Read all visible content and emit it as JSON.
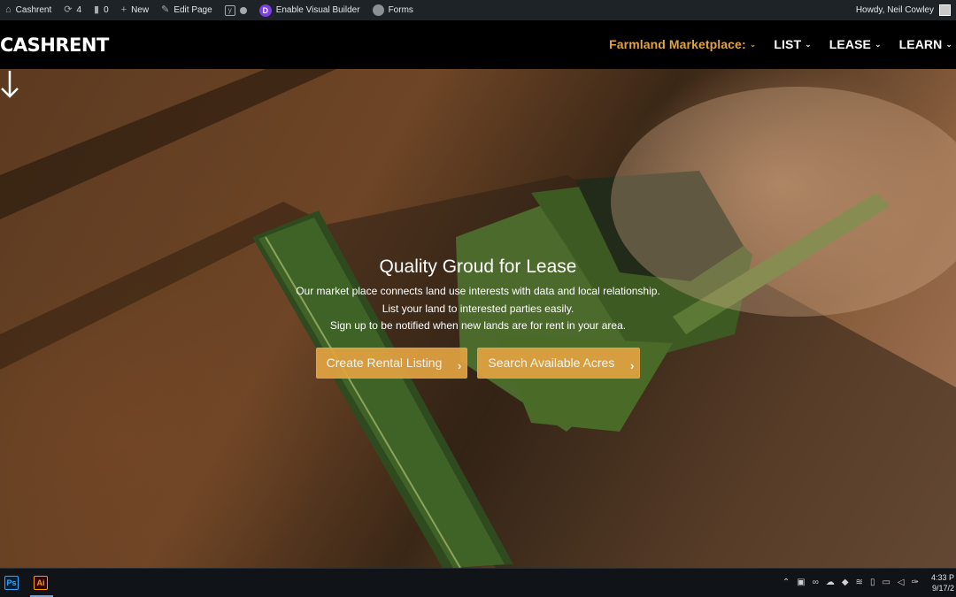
{
  "adminbar": {
    "site_name": "Cashrent",
    "updates_count": "4",
    "comments_count": "0",
    "new_label": "New",
    "edit_page_label": "Edit Page",
    "divi_letter": "D",
    "visual_builder_label": "Enable Visual Builder",
    "forms_label": "Forms",
    "howdy_label": "Howdy, Neil Cowley"
  },
  "header": {
    "logo": "CASHRENT",
    "nav": [
      {
        "label": "Farmland Marketplace:",
        "active": true
      },
      {
        "label": "LIST"
      },
      {
        "label": "LEASE"
      },
      {
        "label": "LEARN"
      }
    ]
  },
  "hero": {
    "title": "Quality Groud for Lease",
    "lines": [
      "Our market place connects land use interests with data and local relationship.",
      "List your land to interested parties easily.",
      "Sign up to be notified when new lands are for rent in your area."
    ],
    "buttons": [
      {
        "label": "Create Rental Listing"
      },
      {
        "label": "Search Available Acres"
      }
    ]
  },
  "taskbar": {
    "apps": [
      "Ps",
      "Ai"
    ],
    "time": "4:33 P",
    "date": "9/17/2"
  },
  "colors": {
    "accent": "#e3a341",
    "adminbar": "#1d2327",
    "header": "#000000"
  }
}
